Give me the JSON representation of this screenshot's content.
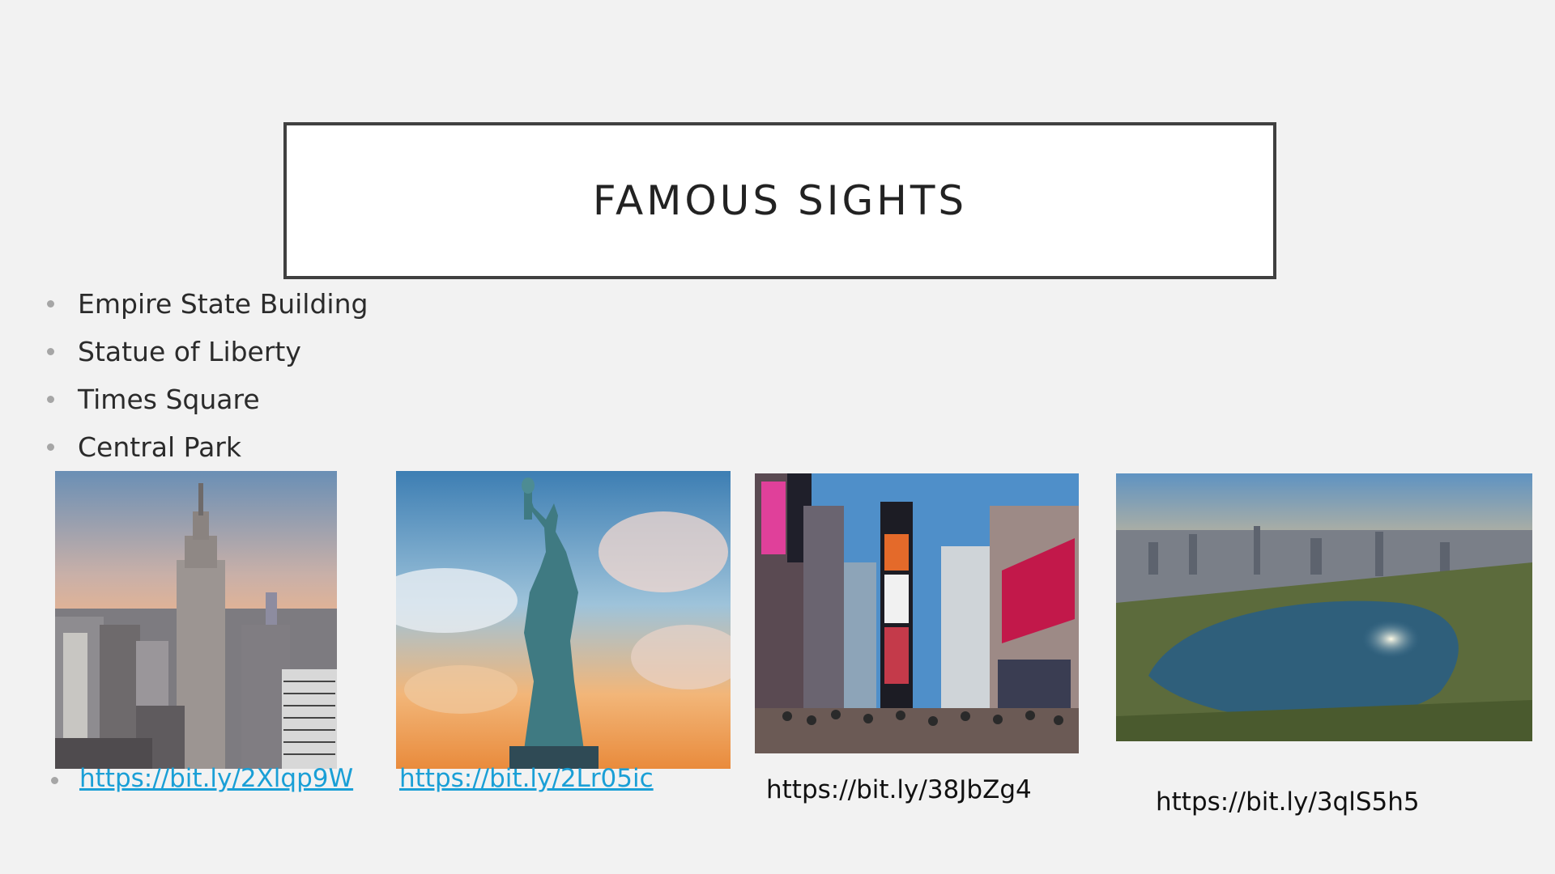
{
  "title": "FAMOUS SIGHTS",
  "bullets": [
    "Empire State Building",
    "Statue of Liberty",
    "Times Square",
    "Central Park"
  ],
  "images": [
    {
      "alt": "Empire State Building skyline photo",
      "link": "https://bit.ly/2Xlqp9W",
      "link_style": "hyperlink"
    },
    {
      "alt": "Statue of Liberty photo",
      "link": "https://bit.ly/2Lr05ic",
      "link_style": "hyperlink"
    },
    {
      "alt": "Times Square photo",
      "link": "https://bit.ly/38JbZg4",
      "link_style": "plain"
    },
    {
      "alt": "Central Park aerial photo",
      "link": "https://bit.ly/3qlS5h5",
      "link_style": "plain"
    }
  ],
  "colors": {
    "background": "#f2f2f2",
    "title_border": "#404040",
    "hyperlink": "#1a9fd6",
    "bullet_dot": "#a6a6a6"
  }
}
